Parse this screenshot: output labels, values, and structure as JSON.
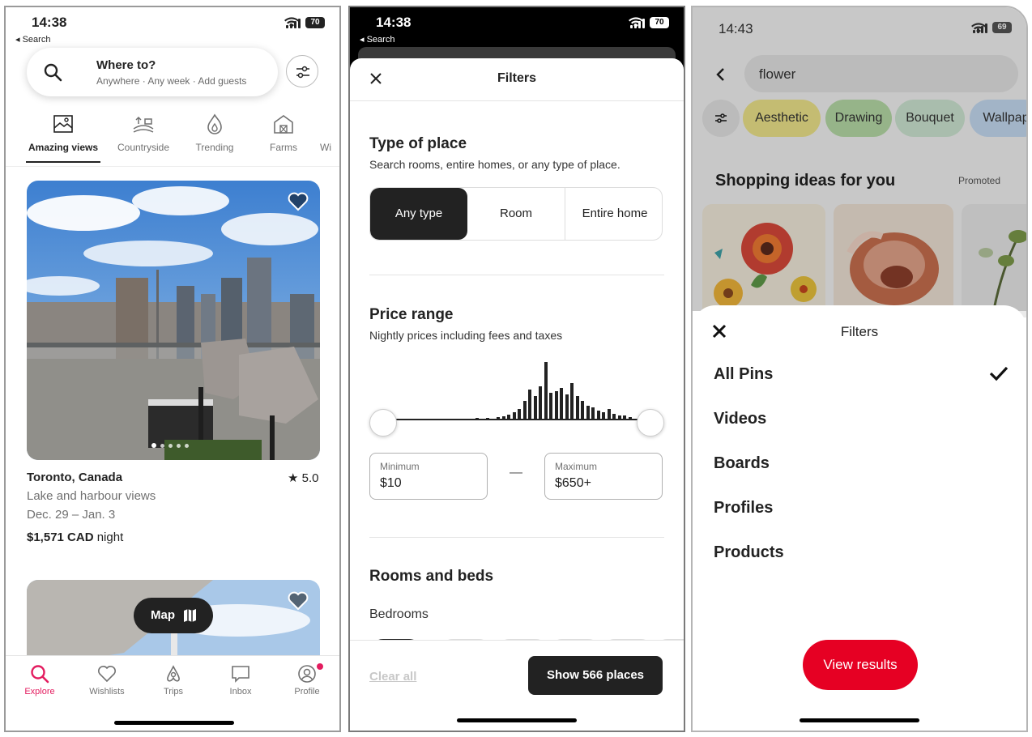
{
  "panel1": {
    "status": {
      "time": "14:38",
      "back": "◂ Search",
      "battery": "70"
    },
    "search": {
      "title": "Where to?",
      "subtitle": "Anywhere · Any week · Add guests"
    },
    "categories": [
      {
        "label": "Amazing views",
        "icon": "framed-picture-icon"
      },
      {
        "label": "Countryside",
        "icon": "countryside-icon"
      },
      {
        "label": "Trending",
        "icon": "flame-icon"
      },
      {
        "label": "Farms",
        "icon": "barn-icon"
      },
      {
        "label": "Wi",
        "icon": "partial-icon"
      }
    ],
    "listing": {
      "location": "Toronto, Canada",
      "rating": "★ 5.0",
      "description": "Lake and harbour views",
      "dates": "Dec. 29 – Jan. 3",
      "price": "$1,571 CAD",
      "price_unit": " night"
    },
    "map_button": "Map",
    "tabs": [
      {
        "label": "Explore",
        "icon": "search-icon"
      },
      {
        "label": "Wishlists",
        "icon": "heart-icon"
      },
      {
        "label": "Trips",
        "icon": "airbnb-logo-icon"
      },
      {
        "label": "Inbox",
        "icon": "message-icon"
      },
      {
        "label": "Profile",
        "icon": "profile-icon"
      }
    ],
    "accent": "#e31c5f"
  },
  "panel2": {
    "status": {
      "time": "14:38",
      "back": "◂ Search",
      "battery": "70"
    },
    "title": "Filters",
    "type_of_place": {
      "heading": "Type of place",
      "subtitle": "Search rooms, entire homes, or any type of place.",
      "options": [
        "Any type",
        "Room",
        "Entire home"
      ],
      "selected": "Any type"
    },
    "price_range": {
      "heading": "Price range",
      "subtitle": "Nightly prices including fees and taxes",
      "min_label": "Minimum",
      "min_value": "$10",
      "dash": "—",
      "max_label": "Maximum",
      "max_value": "$650+"
    },
    "rooms_and_beds": {
      "heading": "Rooms and beds",
      "bedrooms": "Bedrooms"
    },
    "clear_all": "Clear all",
    "show_button": "Show 566 places"
  },
  "panel3": {
    "status": {
      "time": "14:43",
      "battery": "69"
    },
    "search_value": "flower",
    "chips": [
      {
        "label": "Aesthetic",
        "color": "#f0e68c"
      },
      {
        "label": "Drawing",
        "color": "#b7dca8"
      },
      {
        "label": "Bouquet",
        "color": "#cfe7d3"
      },
      {
        "label": "Wallpap",
        "color": "#c6dcf3"
      }
    ],
    "promo_title": "Shopping ideas for you",
    "promo_tag": "Promoted",
    "filters_title": "Filters",
    "options": [
      "All Pins",
      "Videos",
      "Boards",
      "Profiles",
      "Products"
    ],
    "selected_option": "All Pins",
    "view_results": "View results",
    "accent": "#e60023"
  }
}
